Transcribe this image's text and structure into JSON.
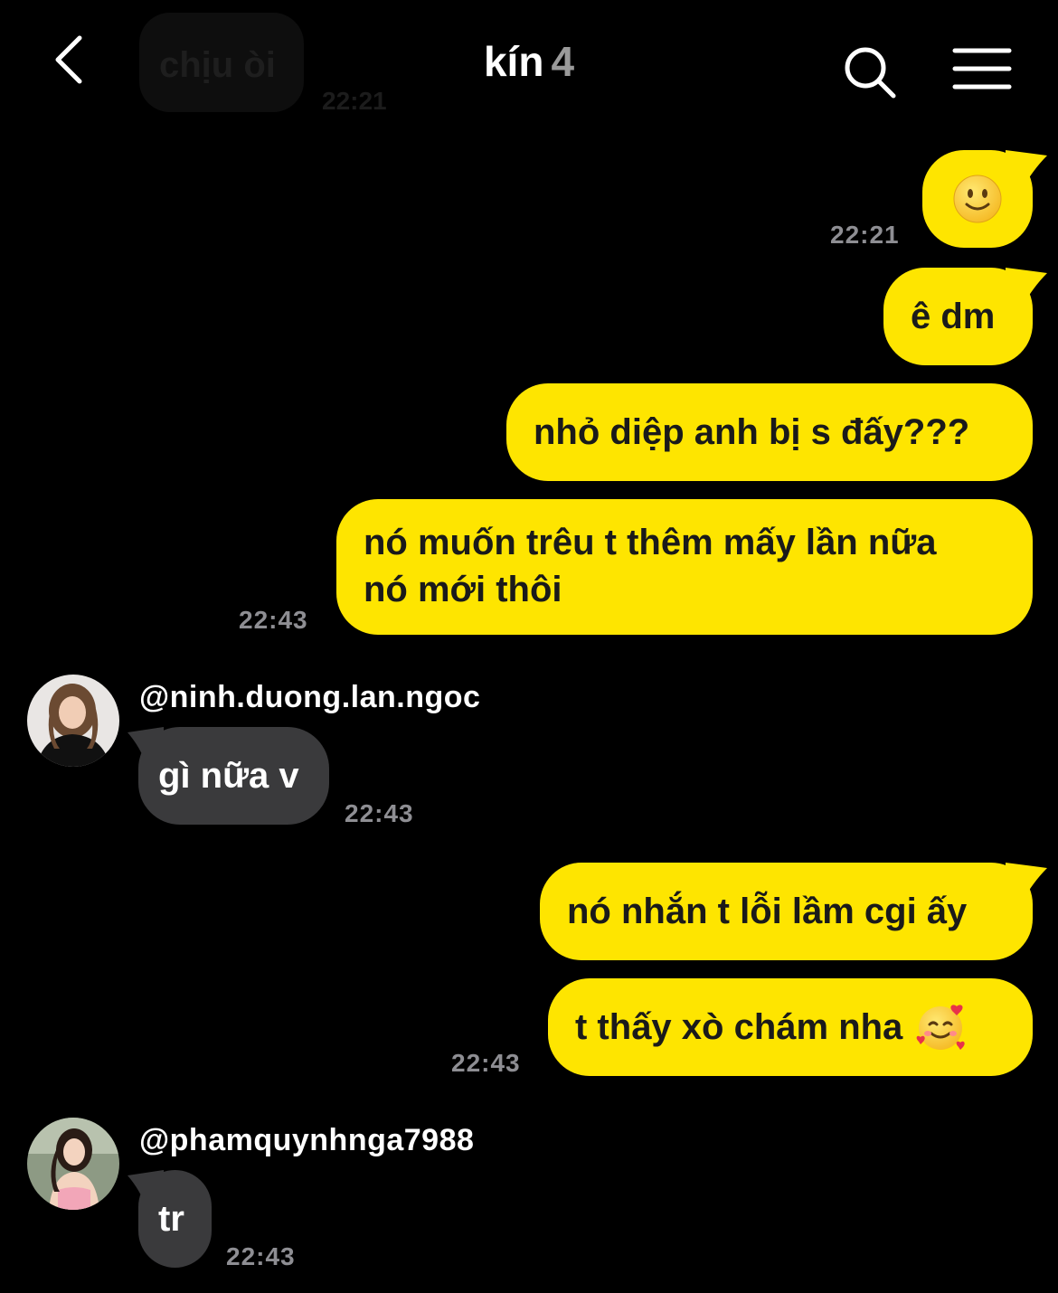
{
  "header": {
    "title": "kín",
    "member_count": "4"
  },
  "messages": {
    "m0": {
      "text": "chịu òi",
      "time": "22:21"
    },
    "m1": {
      "time": "22:21"
    },
    "m2": {
      "text": "ê dm"
    },
    "m3": {
      "text": "nhỏ diệp anh bị s đấy???"
    },
    "m4": {
      "line1": "nó muốn trêu t thêm mấy lần nữa",
      "line2": "nó mới thôi",
      "time": "22:43"
    },
    "m5": {
      "sender": "@ninh.duong.lan.ngoc",
      "text": "gì nữa v",
      "time": "22:43"
    },
    "m6": {
      "text": "nó nhắn t lỗi lầm cgi ấy"
    },
    "m7": {
      "text": "t thấy xò chám nha",
      "time": "22:43"
    },
    "m8": {
      "sender": "@phamquynhnga7988",
      "text": "tr",
      "time": "22:43"
    }
  },
  "icons": {
    "back": "chevron-left-icon",
    "search": "search-icon",
    "menu": "hamburger-menu-icon",
    "smile_emoji": "slightly-smiling-face-icon",
    "hearts_emoji": "smiling-face-with-hearts-icon"
  },
  "colors": {
    "background": "#000000",
    "my_bubble": "#fee500",
    "their_bubble": "#3a3a3c",
    "timestamp": "#8e8e93"
  }
}
